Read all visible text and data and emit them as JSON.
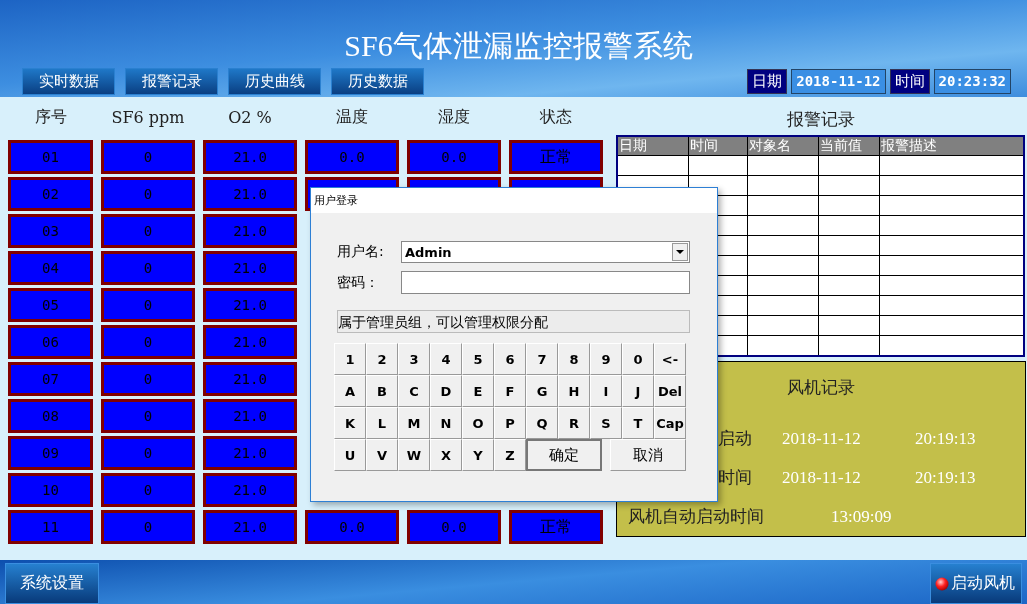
{
  "title": "SF6气体泄漏监控报警系统",
  "nav": [
    "实时数据",
    "报警记录",
    "历史曲线",
    "历史数据"
  ],
  "clock": {
    "date_label": "日期",
    "date": "2018-11-12",
    "time_label": "时间",
    "time": "20:23:32"
  },
  "columns": [
    "序号",
    "SF6 ppm",
    "O2 %",
    "温度",
    "湿度",
    "状态"
  ],
  "rows": [
    {
      "seq": "01",
      "sf6": "0",
      "o2": "21.0",
      "temp": "0.0",
      "humidity": "0.0",
      "status": "正常"
    },
    {
      "seq": "02",
      "sf6": "0",
      "o2": "21.0",
      "covered_cells": true
    },
    {
      "seq": "03",
      "sf6": "0",
      "o2": "21.0"
    },
    {
      "seq": "04",
      "sf6": "0",
      "o2": "21.0"
    },
    {
      "seq": "05",
      "sf6": "0",
      "o2": "21.0"
    },
    {
      "seq": "06",
      "sf6": "0",
      "o2": "21.0"
    },
    {
      "seq": "07",
      "sf6": "0",
      "o2": "21.0"
    },
    {
      "seq": "08",
      "sf6": "0",
      "o2": "21.0"
    },
    {
      "seq": "09",
      "sf6": "0",
      "o2": "21.0"
    },
    {
      "seq": "10",
      "sf6": "0",
      "o2": "21.0"
    },
    {
      "seq": "11",
      "sf6": "0",
      "o2": "21.0",
      "temp": "0.0",
      "humidity": "0.0",
      "status": "正常"
    }
  ],
  "alarm": {
    "title": "报警记录",
    "columns": [
      "日期",
      "时间",
      "对象名",
      "当前值",
      "报警描述"
    ]
  },
  "fan": {
    "title": "风机记录",
    "entries": [
      {
        "kind": "cut",
        "label": "启动",
        "date": "2018-11-12",
        "time": "20:19:13"
      },
      {
        "kind": "cut",
        "label": "时间",
        "date": "2018-11-12",
        "time": "20:19:13"
      },
      {
        "kind": "full",
        "label": "风机自动启动时间",
        "time": "13:09:09"
      }
    ]
  },
  "dialog": {
    "title": "用户登录",
    "username_label": "用户名:",
    "username": "Admin",
    "password_label": "密码：",
    "description": "属于管理员组，可以管理权限分配",
    "keys": [
      [
        "1",
        "2",
        "3",
        "4",
        "5",
        "6",
        "7",
        "8",
        "9",
        "0",
        "<-"
      ],
      [
        "A",
        "B",
        "C",
        "D",
        "E",
        "F",
        "G",
        "H",
        "I",
        "J",
        "Del"
      ],
      [
        "K",
        "L",
        "M",
        "N",
        "O",
        "P",
        "Q",
        "R",
        "S",
        "T",
        "Cap"
      ],
      [
        "U",
        "V",
        "W",
        "X",
        "Y",
        "Z"
      ]
    ],
    "ok": "确定",
    "cancel": "取消"
  },
  "footer": {
    "settings": "系统设置",
    "fan_button": "启动风机"
  }
}
